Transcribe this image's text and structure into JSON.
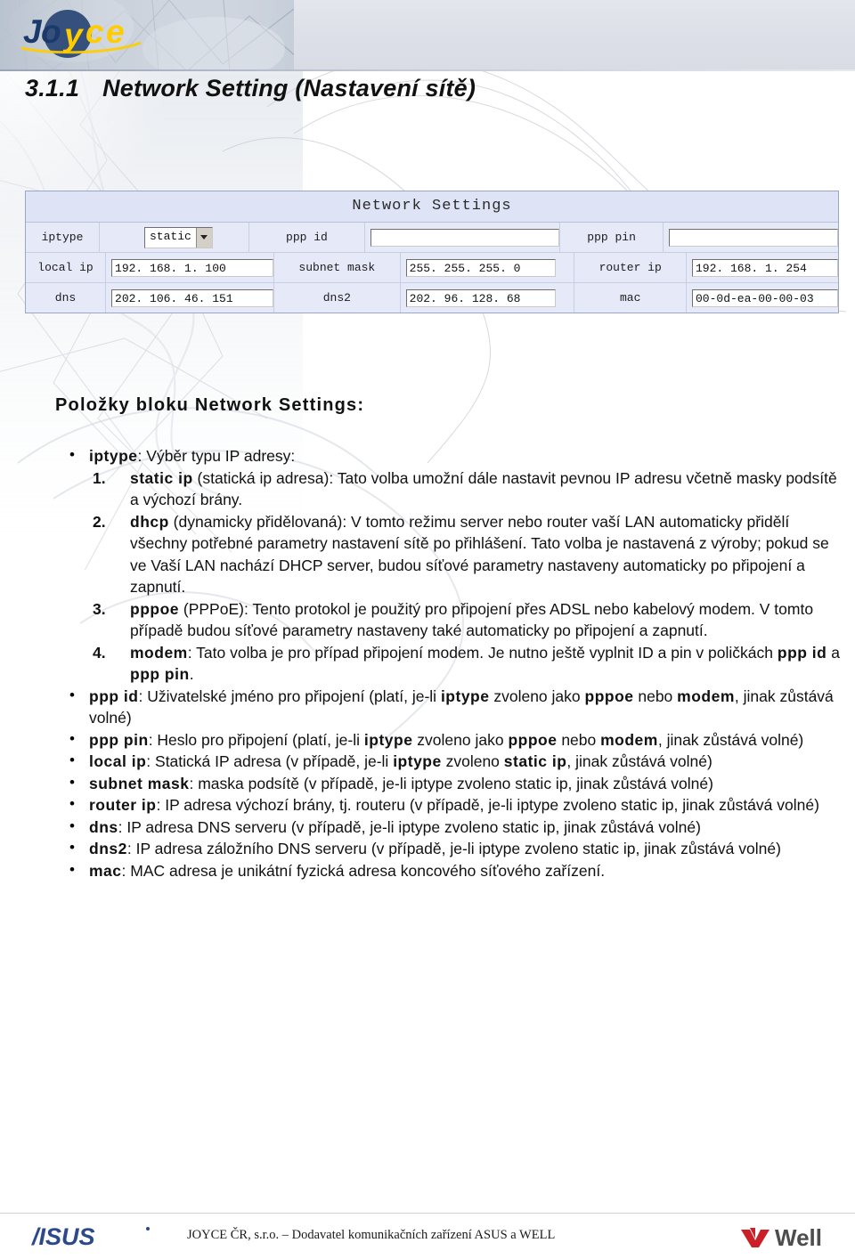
{
  "header": {
    "logo_alt": "JOYCE",
    "logo_colors": {
      "dark_blue": "#1b3a6b",
      "gold": "#ffcc00"
    }
  },
  "title": {
    "number": "3.1.1",
    "text": "Network Setting (Nastavení sítě)"
  },
  "screenshot": {
    "panel_title": "Network Settings",
    "rows": [
      {
        "left_label": "iptype",
        "left_control": {
          "type": "select",
          "value": "static"
        },
        "right_label": "ppp id",
        "right_control": {
          "type": "text",
          "value": ""
        },
        "far_label": "ppp pin",
        "far_control": {
          "type": "text",
          "value": ""
        }
      },
      {
        "left_label": "local ip",
        "left_control": {
          "type": "text",
          "value": "192. 168. 1. 100"
        },
        "right_label": "subnet mask",
        "right_control": {
          "type": "text",
          "value": "255. 255. 255. 0"
        },
        "far_label": "router ip",
        "far_control": {
          "type": "text",
          "value": "192. 168. 1. 254"
        }
      },
      {
        "left_label": "dns",
        "left_control": {
          "type": "text",
          "value": "202. 106. 46. 151"
        },
        "right_label": "dns2",
        "right_control": {
          "type": "text",
          "value": "202. 96. 128. 68"
        },
        "far_label": "mac",
        "far_control": {
          "type": "text",
          "value": "00-0d-ea-00-00-03"
        }
      }
    ],
    "panel_bg": "#e6eaf8"
  },
  "section_heading": "Položky bloku Network Settings:",
  "body": {
    "iptype_label": "iptype",
    "iptype_intro": ": Výběr typu IP adresy:",
    "numbered": [
      {
        "n": "1.",
        "term": "static ip",
        "rest": " (statická ip adresa): Tato volba umožní dále nastavit pevnou IP adresu včetně masky podsítě a výchozí brány."
      },
      {
        "n": "2.",
        "term": "dhcp",
        "rest": " (dynamicky přidělovaná): V tomto režimu server nebo router vaší LAN automaticky přidělí všechny potřebné parametry nastavení sítě po přihlášení. Tato volba je nastavená z výroby; pokud se ve Vaší LAN nachází DHCP server, budou síťové parametry nastaveny automaticky po připojení a zapnutí."
      },
      {
        "n": "3.",
        "term": "pppoe",
        "rest": " (PPPoE): Tento protokol je použitý pro připojení přes ADSL nebo kabelový modem. V tomto případě budou síťové parametry nastaveny také automaticky po připojení a zapnutí."
      },
      {
        "n": "4.",
        "term": "modem",
        "rest_a": ": Tato volba je pro případ připojení modem. Je nutno ještě vyplnit ID a pin v poličkách ",
        "bold_a": "ppp id",
        "mid": " a ",
        "bold_b": "ppp pin",
        "rest_b": "."
      }
    ],
    "bullets": [
      {
        "term": "ppp id",
        "a": ": Uživatelské jméno pro připojení (platí, je-li ",
        "b1": "iptype",
        "b": " zvoleno jako ",
        "b2": "pppoe",
        "c": " nebo ",
        "b3": "modem",
        "d": ", jinak zůstává volné)"
      },
      {
        "term": "ppp pin",
        "a": ": Heslo pro připojení (platí, je-li ",
        "b1": "iptype",
        "b": " zvoleno jako ",
        "b2": "pppoe",
        "c": " nebo ",
        "b3": "modem",
        "d": ", jinak zůstává volné)"
      },
      {
        "term": "local ip",
        "a": ": Statická IP adresa (v případě, je-li ",
        "b1": "iptype",
        "b": " zvoleno ",
        "b2": "static ip",
        "c": ", jinak zůstává volné)"
      },
      {
        "term": "subnet mask",
        "a": ": maska podsítě (v případě, je-li iptype zvoleno static ip, jinak zůstává volné)"
      },
      {
        "term": "router ip",
        "a": ": IP adresa výchozí brány, tj. routeru (v případě, je-li iptype zvoleno static ip, jinak zůstává volné)"
      },
      {
        "term": "dns",
        "a": ": IP adresa DNS serveru (v případě, je-li iptype zvoleno static ip, jinak zůstává volné)"
      },
      {
        "term": "dns2",
        "a": ": IP adresa záložního DNS serveru (v případě, je-li iptype zvoleno static ip, jinak zůstává volné)"
      },
      {
        "term": "mac",
        "a": ": MAC adresa je unikátní fyzická adresa koncového síťového zařízení."
      }
    ]
  },
  "footer": {
    "asus_alt": "ASUS",
    "text": "JOYCE ČR, s.r.o. – Dodavatel komunikačních zařízení ASUS a WELL",
    "well_alt": "Well",
    "well_mark_color": "#cc2029",
    "well_text_color": "#4d4d4d",
    "asus_color": "#2c4a8a"
  }
}
